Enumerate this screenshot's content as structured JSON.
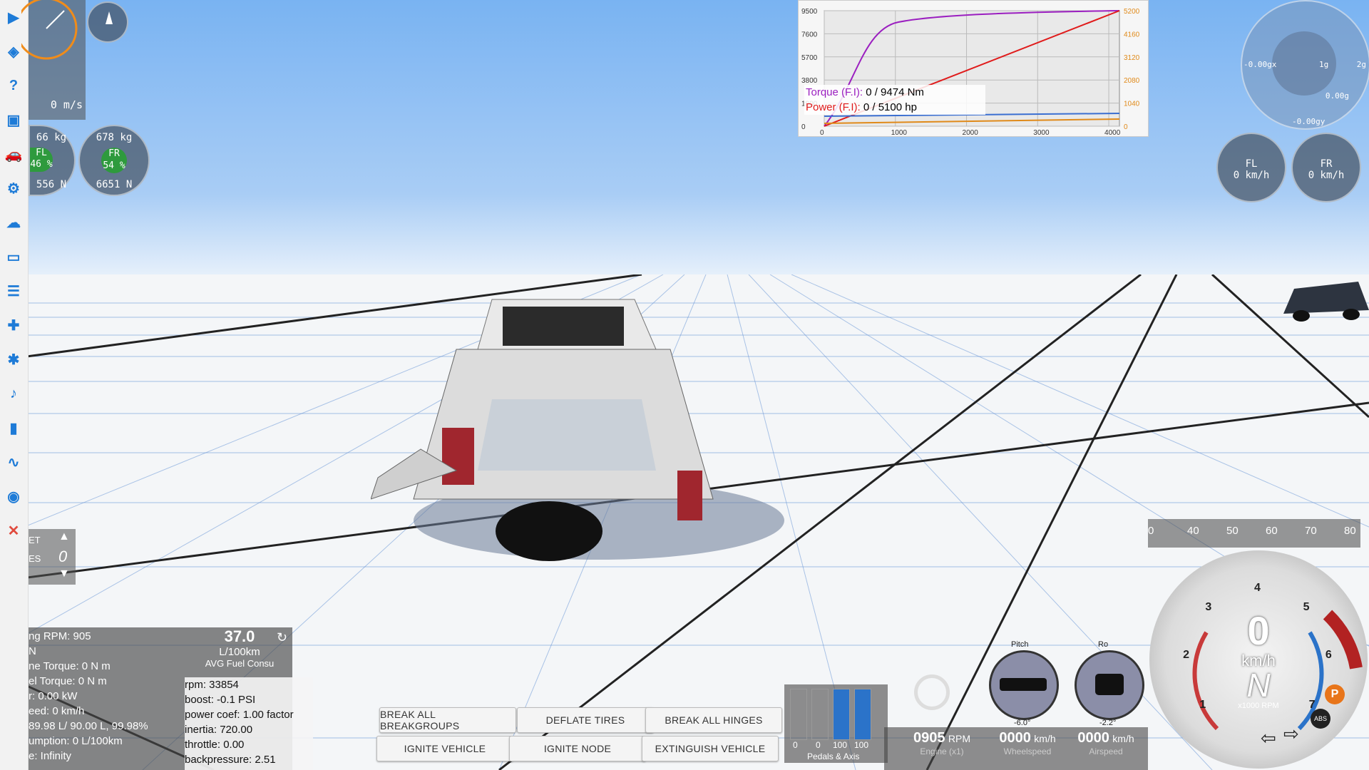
{
  "toolbar": {
    "icons": [
      "play-icon",
      "layers-icon",
      "help-icon",
      "camera-film-icon",
      "vehicle-icon",
      "settings-icon",
      "cloud-icon",
      "window-icon",
      "sliders-icon",
      "gamepad-icon",
      "bug-icon",
      "sound-icon",
      "bar-chart-icon",
      "path-icon",
      "camera-icon",
      "close-icon"
    ]
  },
  "speed_panel": {
    "value": "0 m/s"
  },
  "wheel_weight": {
    "fl": {
      "kg": "66 kg",
      "name": "FL",
      "pct": "46 %",
      "newton": "556 N"
    },
    "fr": {
      "kg": "678 kg",
      "name": "FR",
      "pct": "54 %",
      "newton": "6651 N"
    }
  },
  "wheel_speed": {
    "fl": {
      "name": "FL",
      "value": "0 km/h"
    },
    "fr": {
      "name": "FR",
      "value": "0 km/h"
    }
  },
  "gforce": {
    "x_label": "-0.00gx",
    "right_label": "2g",
    "mid_label": "1g",
    "z_label": "0.00g",
    "y_label": "-0.00gy"
  },
  "torque_graph": {
    "left_ticks": [
      "9500",
      "7600",
      "5700",
      "3800",
      "1900",
      "0"
    ],
    "right_ticks": [
      "5200",
      "4160",
      "3120",
      "2080",
      "1040",
      "0"
    ],
    "x_ticks": [
      "0",
      "1000",
      "2000",
      "3000",
      "4000"
    ],
    "torque_label": "Torque (F.I):",
    "torque_value": "0 / 9474 Nm",
    "power_label": "Power (F.I):",
    "power_value": "0 / 5100 hp",
    "colors": {
      "torque": "#9b1fc0",
      "power": "#e01b1b",
      "blue": "#3b6fd1",
      "orange": "#e08a1a"
    }
  },
  "engine_info": {
    "lines": [
      "ng RPM: 905",
      "N",
      "ne Torque: 0 N m",
      "el Torque: 0 N m",
      "r: 0.00 kW",
      "eed: 0 km/h",
      "89.98 L/ 90.00 L, 99.98%",
      "umption: 0 L/100km",
      "e: Infinity"
    ],
    "fuel_value": "37.0",
    "fuel_unit": "L/100km",
    "fuel_label": "AVG Fuel Consu"
  },
  "turbo_info": {
    "lines": [
      "rpm: 33854",
      "boost: -0.1 PSI",
      "power coef: 1.00 factor",
      "inertia: 720.00",
      "throttle: 0.00",
      "backpressure: 2.51"
    ]
  },
  "actions": {
    "break_breakgroups": "BREAK ALL BREAKGROUPS",
    "deflate_tires": "DEFLATE TIRES",
    "break_hinges": "BREAK ALL HINGES",
    "ignite_vehicle": "IGNITE VEHICLE",
    "ignite_node": "IGNITE NODE",
    "extinguish_vehicle": "EXTINGUISH VEHICLE"
  },
  "pedals": {
    "values": [
      "0",
      "0",
      "100",
      "100"
    ],
    "label": "Pedals & Axis"
  },
  "readouts": {
    "engine_value": "0905",
    "engine_unit": "RPM",
    "engine_label": "Engine (x1)",
    "wheel_value": "0000",
    "wheel_unit": "km/h",
    "wheel_label": "Wheelspeed",
    "air_value": "0000",
    "air_unit": "km/h",
    "air_label": "Airspeed"
  },
  "attitude": {
    "pitch_label": "Pitch",
    "pitch_value": "-6.0°",
    "roll_label": "Ro",
    "roll_value": "-2.2°"
  },
  "gear_panel": {
    "labels": [
      "ET",
      "ES"
    ],
    "gear": "0"
  },
  "speedo_scale": {
    "ticks": [
      "0",
      "40",
      "50",
      "60",
      "70",
      "80"
    ]
  },
  "speedometer": {
    "speed": "0",
    "unit": "km/h",
    "gear": "N",
    "rpm_label": "x1000 RPM",
    "rpm_ticks": [
      "1",
      "2",
      "3",
      "4",
      "5",
      "6",
      "7"
    ],
    "park_badge": "P",
    "abs_badge": "ABS"
  }
}
